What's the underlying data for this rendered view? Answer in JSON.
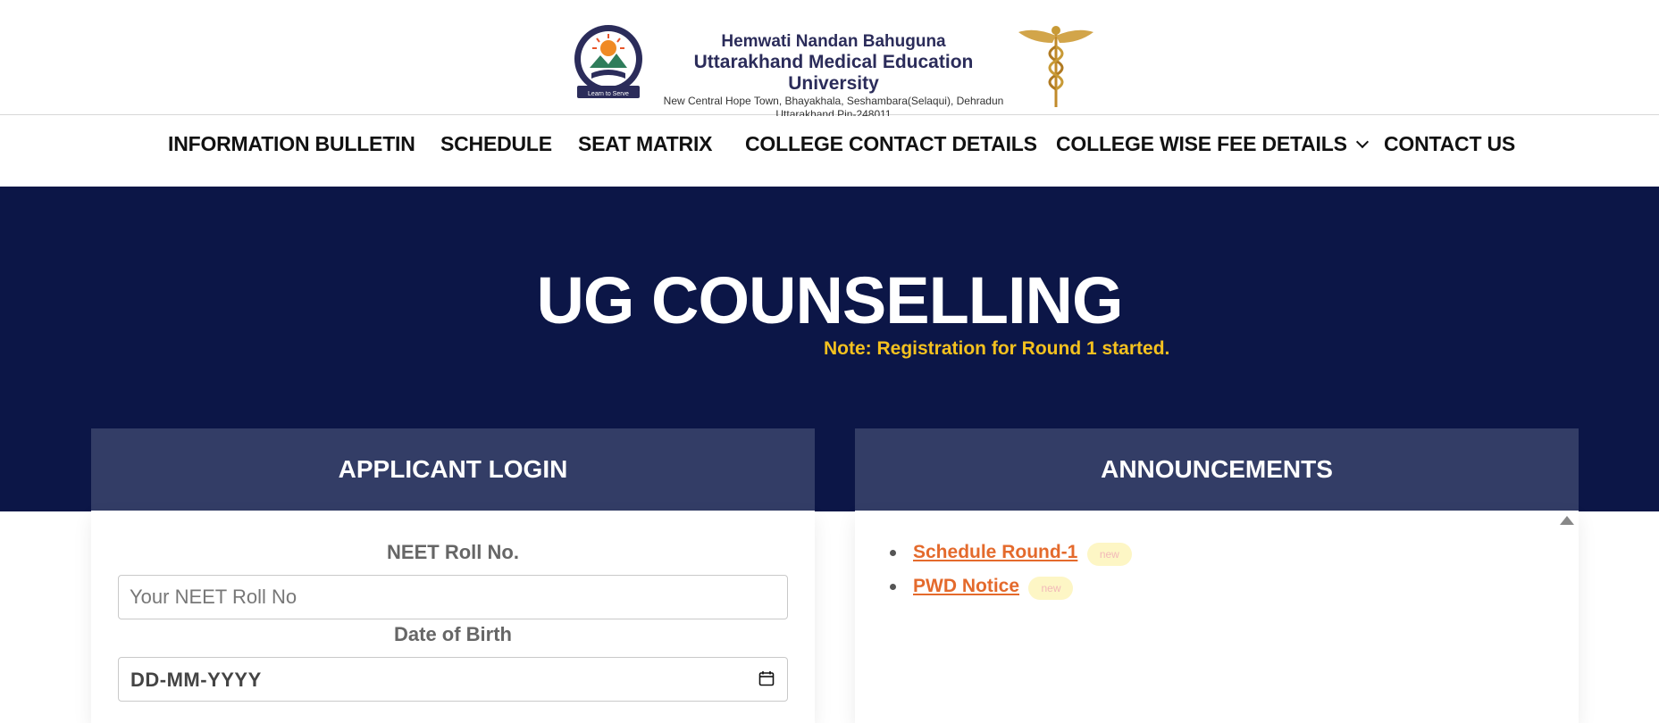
{
  "header": {
    "university_line1": "Hemwati Nandan Bahuguna",
    "university_line2": "Uttarakhand Medical Education University",
    "address_line1": "New Central Hope Town, Bhayakhala, Seshambara(Selaqui), Dehradun",
    "address_line2": "Uttarakhand Pin-248011",
    "seal_motto": "Learn to Serve",
    "seal_icon": "university-seal-icon",
    "emblem_icon": "caduceus-icon"
  },
  "nav": {
    "items": [
      {
        "label": "INFORMATION BULLETIN"
      },
      {
        "label": "SCHEDULE"
      },
      {
        "label": "SEAT MATRIX"
      },
      {
        "label": "COLLEGE CONTACT DETAILS"
      },
      {
        "label": "COLLEGE WISE FEE DETAILS"
      },
      {
        "label": "CONTACT US"
      }
    ]
  },
  "hero": {
    "title": "UG COUNSELLING",
    "note": "Note: Registration for Round 1 started."
  },
  "login": {
    "heading": "APPLICANT LOGIN",
    "roll_label": "NEET Roll No.",
    "roll_placeholder": "Your NEET Roll No",
    "roll_value": "",
    "dob_label": "Date of Birth",
    "dob_placeholder": "DD-MM-YYYY"
  },
  "announcements": {
    "heading": "ANNOUNCEMENTS",
    "items": [
      {
        "label": "Schedule Round-1",
        "badge": "new"
      },
      {
        "label": "PWD Notice",
        "badge": "new"
      }
    ]
  },
  "colors": {
    "hero_bg": "#0c1647",
    "panel_header_bg": "#333d66",
    "note_yellow": "#f4c11f",
    "link_orange": "#e46a2c"
  }
}
